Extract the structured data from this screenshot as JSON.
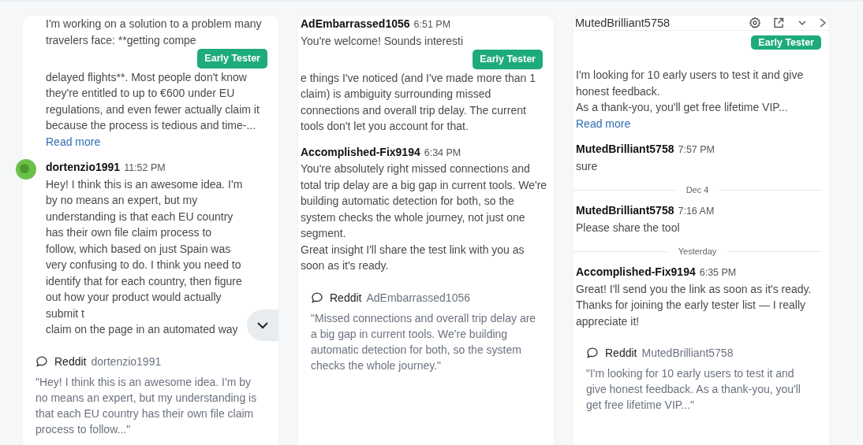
{
  "cards": [
    {
      "items": [
        {
          "kind": "message",
          "parts": [
            {
              "kind": "text",
              "text": "I'm working on a solution to a problem many travelers face: **getting compe"
            },
            {
              "kind": "badge",
              "text": "Early Tester"
            },
            {
              "kind": "text",
              "text": "delayed flights**. Most people don't know they're entitled to up to €600 under EU regulations, and even fewer actually claim it because the process is tedious and time-..."
            }
          ],
          "read_more": "Read more"
        },
        {
          "kind": "message",
          "avatar": true,
          "author": "dortenzio1991",
          "time": "11:52 PM",
          "parts": [
            {
              "kind": "text",
              "text": "Hey! I think this is an awesome idea. I'm by no means an expert, but my understanding is that each EU country has their own file claim process to follow, which based on just Spain was very confusing to do. I think you need to identify that for each country, then figure out how your product would actually submit t"
            },
            {
              "kind": "text",
              "text": "claim on the page in an automated way"
            }
          ],
          "scroll_button": true
        },
        {
          "kind": "reference",
          "source": "Reddit",
          "author": "dortenzio1991",
          "quote": "\"Hey! I think this is an awesome idea. I'm by no means an expert, but my understanding is that each EU country has their own file claim process to follow...\""
        }
      ]
    },
    {
      "items": [
        {
          "kind": "message",
          "author": "AdEmbarrassed1056",
          "time": "6:51 PM",
          "parts": [
            {
              "kind": "text",
              "text": "You're welcome! Sounds interesti"
            },
            {
              "kind": "badge",
              "text": "Early Tester"
            },
            {
              "kind": "text",
              "text": "e things I've noticed (and I've made more than 1 claim) is ambiguity surrounding missed connections and overall trip delay. The current tools don't let you account for that."
            }
          ]
        },
        {
          "kind": "message",
          "author": "Accomplished-Fix9194",
          "time": "6:34 PM",
          "parts": [
            {
              "kind": "text",
              "text": "You're absolutely right missed connections and total trip delay are a big gap in current tools. We're building automatic detection for both, so the system checks the whole journey, not just one segment.\nGreat insight I'll share the test link with you as soon as it's ready."
            }
          ]
        },
        {
          "kind": "reference",
          "source": "Reddit",
          "author": "AdEmbarrassed1056",
          "quote": "\"Missed connections and overall trip delay are a big gap in current tools. We're building automatic detection for both, so the system checks the whole journey.\""
        }
      ]
    },
    {
      "header": {
        "title": "MutedBrilliant5758"
      },
      "items": [
        {
          "kind": "badge",
          "text": "Early Tester"
        },
        {
          "kind": "message",
          "parts": [
            {
              "kind": "text",
              "text": "I'm looking for 10 early users to test it and give honest feedback.\nAs a thank-you, you'll get free lifetime VIP..."
            }
          ],
          "read_more": "Read more"
        },
        {
          "kind": "message",
          "author": "MutedBrilliant5758",
          "time": "7:57 PM",
          "parts": [
            {
              "kind": "text",
              "text": "sure"
            }
          ]
        },
        {
          "kind": "divider",
          "label": "Dec 4"
        },
        {
          "kind": "message",
          "author": "MutedBrilliant5758",
          "time": "7:16 AM",
          "parts": [
            {
              "kind": "text",
              "text": "Please share the tool"
            }
          ]
        },
        {
          "kind": "divider",
          "label": "Yesterday"
        },
        {
          "kind": "message",
          "author": "Accomplished-Fix9194",
          "time": "6:35 PM",
          "parts": [
            {
              "kind": "text",
              "text": "Great! I'll send you the link as soon as it's ready.\nThanks for joining the early tester list — I really appreciate it!"
            }
          ]
        },
        {
          "kind": "reference",
          "source": "Reddit",
          "author": "MutedBrilliant5758",
          "quote": "\"I'm looking for 10 early users to test it and give honest feedback. As a thank-you, you'll get free lifetime VIP...\""
        }
      ]
    }
  ]
}
